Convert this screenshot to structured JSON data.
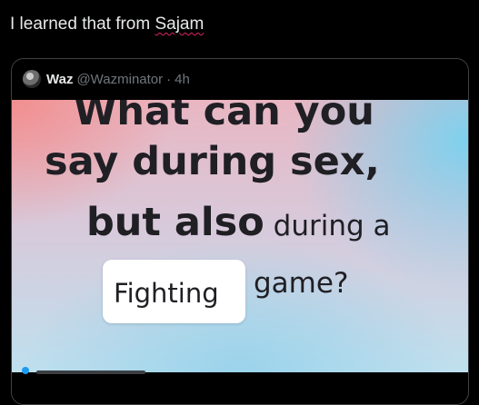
{
  "compose": {
    "text_prefix": "I learned that from ",
    "mention": "Sajam"
  },
  "quote": {
    "display_name": "Waz",
    "handle": "@Wazminator",
    "separator": "·",
    "time": "4h",
    "image": {
      "line1": "What can you",
      "line2": "say during sex,",
      "line3_bold": "but also",
      "line3_rest": " during a",
      "box_word": "Fighting",
      "after_box": "game?"
    }
  },
  "colors": {
    "background": "#000000",
    "text": "#e7e9ea",
    "muted": "#71767b",
    "border": "#3e4144",
    "spellcheck": "#e0245e",
    "accent": "#1d9bf0"
  }
}
